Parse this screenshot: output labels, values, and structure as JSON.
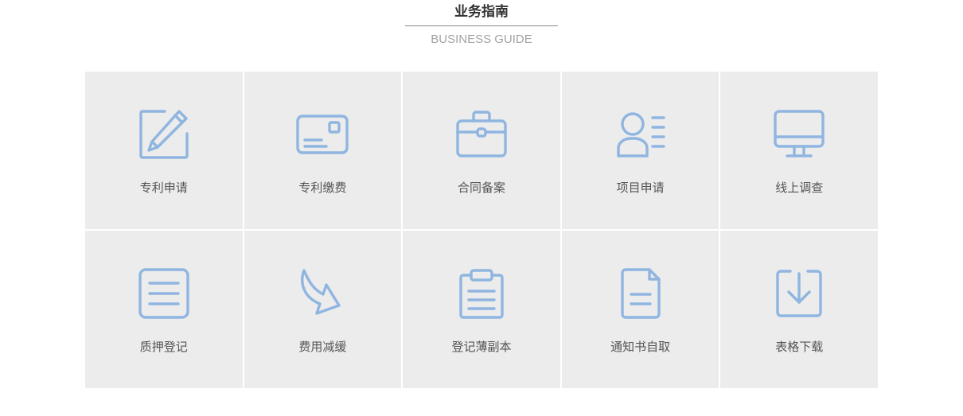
{
  "header": {
    "title": "业务指南",
    "subtitle": "BUSINESS GUIDE"
  },
  "accent_color": "#8fb5e0",
  "tile_background": "#ececec",
  "tiles": [
    {
      "label": "专利申请",
      "icon": "edit-pencil-icon"
    },
    {
      "label": "专利缴费",
      "icon": "bank-card-icon"
    },
    {
      "label": "合同备案",
      "icon": "briefcase-icon"
    },
    {
      "label": "项目申请",
      "icon": "user-profile-icon"
    },
    {
      "label": "线上调查",
      "icon": "monitor-icon"
    },
    {
      "label": "质押登记",
      "icon": "document-lines-icon"
    },
    {
      "label": "费用减缓",
      "icon": "curved-arrow-icon"
    },
    {
      "label": "登记薄副本",
      "icon": "clipboard-icon"
    },
    {
      "label": "通知书自取",
      "icon": "file-icon"
    },
    {
      "label": "表格下载",
      "icon": "download-icon"
    }
  ]
}
